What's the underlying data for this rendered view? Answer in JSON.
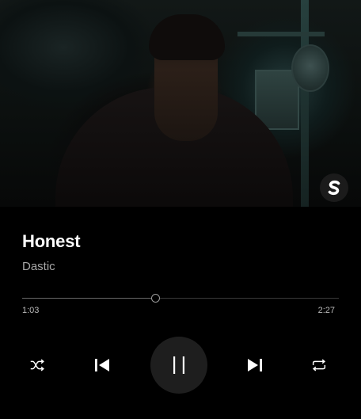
{
  "track": {
    "title": "Honest",
    "artist": "Dastic"
  },
  "playback": {
    "elapsed": "1:03",
    "total": "2:27",
    "progress_fraction": 0.4218,
    "state": "playing"
  },
  "artwork": {
    "badge_icon": "spinnin-records-logo-icon"
  },
  "controls": {
    "shuffle_icon": "shuffle-icon",
    "previous_icon": "skip-previous-icon",
    "play_pause_icon": "pause-icon",
    "next_icon": "skip-next-icon",
    "repeat_icon": "repeat-icon"
  },
  "colors": {
    "background": "#000000",
    "title": "#ffffff",
    "artist": "#a8a8a8",
    "time": "#b9b9b9",
    "play_button_bg": "#1e1e1e",
    "track": "#3a3a3a"
  }
}
